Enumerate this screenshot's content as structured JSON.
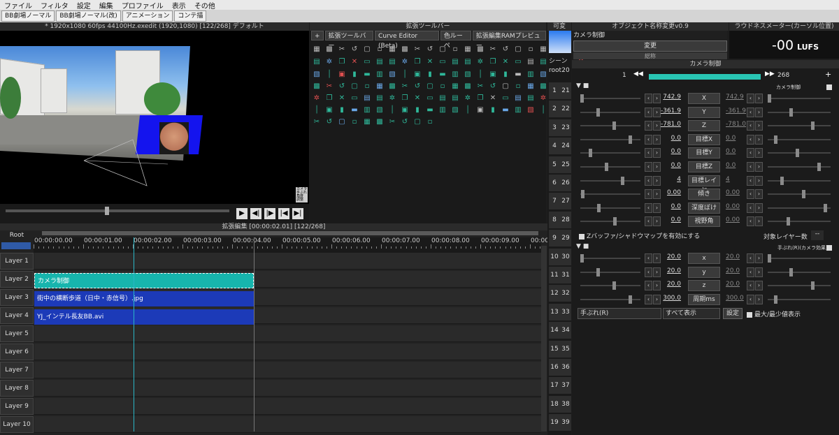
{
  "menubar": [
    "ファイル",
    "フィルタ",
    "設定",
    "編集",
    "プロファイル",
    "表示",
    "その他"
  ],
  "tabs": [
    "BB劇場ノーマル",
    "BB劇場ノーマル(改)",
    "アニメーション",
    "コンテ描"
  ],
  "preview": {
    "title": "* 1920x1080  60fps  44100Hz.exedit (1920,1080)  [122/268]  デフォルト",
    "badge": "カメラ 手ぶれ 角度 調整"
  },
  "toolbar": {
    "header": "拡張ツールバー",
    "tabs": [
      "+",
      "拡張ツールバー",
      "Curve Editor (Beta)",
      "色ルーペ",
      "拡張編集RAMプレビュー"
    ]
  },
  "timeline": {
    "header": "拡張編集 [00:00:02.01] [122/268]",
    "root": "Root",
    "ticks": [
      "00:00:00.00",
      "00:00:01.00",
      "00:00:02.00",
      "00:00:03.00",
      "00:00:04.00",
      "00:00:05.00",
      "00:00:06.00",
      "00:00:07.00",
      "00:00:08.00",
      "00:00:09.00",
      "00:00"
    ],
    "layers": [
      "Layer 1",
      "Layer 2",
      "Layer 3",
      "Layer 4",
      "Layer 5",
      "Layer 6",
      "Layer 7",
      "Layer 8",
      "Layer 9",
      "Layer 10"
    ],
    "clips": {
      "camera": "カメラ制御",
      "image": "街中の横断歩道（日中・赤信号）.jpg",
      "video": "YJ_インテル長友BB.avi"
    }
  },
  "scene": {
    "header": "可変",
    "tab": "シーン",
    "root": "root",
    "root2": "20",
    "left": [
      "1",
      "2",
      "3",
      "4",
      "5",
      "6",
      "7",
      "8",
      "9",
      "10",
      "11",
      "12",
      "13",
      "14",
      "15",
      "16",
      "17",
      "18",
      "19"
    ],
    "right": [
      "21",
      "22",
      "23",
      "24",
      "25",
      "26",
      "27",
      "28",
      "29",
      "30",
      "31",
      "32",
      "33",
      "34",
      "35",
      "36",
      "37",
      "38",
      "39"
    ]
  },
  "rename": {
    "header": "オブジェクト名称変更v0.9",
    "name": "カメラ制御",
    "change": "変更",
    "sub": "総称"
  },
  "loudness": {
    "header": "ラウドネスメーター(カーソル位置)",
    "value": "-00",
    "unit": "LUFS"
  },
  "props": {
    "title": "カメラ制御",
    "frame_start": "1",
    "frame_end": "268",
    "section1": "カメラ制御",
    "rows": [
      {
        "name": "X",
        "val": "742.9",
        "val2": "742.9"
      },
      {
        "name": "Y",
        "val": "-361.9",
        "val2": "-361.9"
      },
      {
        "name": "Z",
        "val": "-781.0",
        "val2": "-781.0"
      },
      {
        "name": "目標X",
        "val": "0.0",
        "val2": "0.0"
      },
      {
        "name": "目標Y",
        "val": "0.0",
        "val2": "0.0"
      },
      {
        "name": "目標Z",
        "val": "0.0",
        "val2": "0.0"
      },
      {
        "name": "目標レイヤ",
        "val": "4",
        "val2": "4"
      },
      {
        "name": "傾き",
        "val": "0.00",
        "val2": "0.00"
      },
      {
        "name": "深度ぼけ",
        "val": "0.0",
        "val2": "0.00"
      },
      {
        "name": "視野角",
        "val": "0.0",
        "val2": "0.00"
      }
    ],
    "zbuffer": "Zバッファ/シャドウマップを有効にする",
    "target_layer": "対象レイヤー数",
    "target_value": "--",
    "section2": "手ぶれ(R)(カメラ効果)",
    "rows2": [
      {
        "name": "x",
        "val": "20.0",
        "val2": "20.0"
      },
      {
        "name": "y",
        "val": "20.0",
        "val2": "20.0"
      },
      {
        "name": "z",
        "val": "20.0",
        "val2": "20.0"
      },
      {
        "name": "周期ms",
        "val": "300.0",
        "val2": "300.0"
      }
    ],
    "filter_select": "手ぶれ(R)",
    "display_select": "すべて表示",
    "settings": "設定",
    "minmax": "最大/最少値表示"
  }
}
